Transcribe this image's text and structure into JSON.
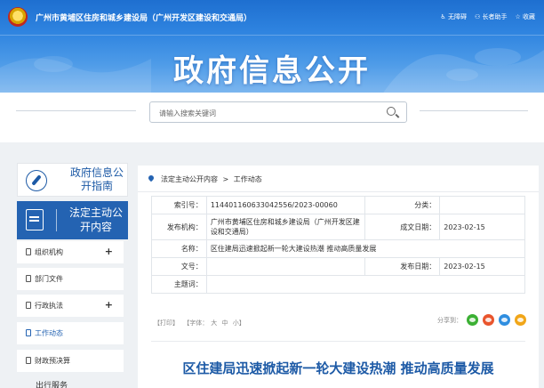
{
  "header": {
    "site_title": "广州市黄埔区住房和城乡建设局（广州开发区建设和交通局）",
    "links": [
      "无障碍",
      "长者助手",
      "收藏"
    ],
    "banner_title": "政府信息公开"
  },
  "search": {
    "placeholder": "请输入搜索关键词"
  },
  "sidebar": {
    "guide_label": "政府信息公开指南",
    "active_label": "法定主动公开内容",
    "items": [
      {
        "label": "组织机构",
        "expandable": true
      },
      {
        "label": "部门文件",
        "expandable": false
      },
      {
        "label": "行政执法",
        "expandable": true
      },
      {
        "label": "工作动态",
        "expandable": false,
        "current": true
      },
      {
        "label": "财政预决算",
        "expandable": false
      }
    ],
    "more_label": "出行服务"
  },
  "breadcrumb": [
    "法定主动公开内容",
    ">",
    "工作动态"
  ],
  "meta": {
    "index_label": "索引号：",
    "index_value": "114401160633042556/2023-00060",
    "category_label": "分类：",
    "category_value": "",
    "org_label": "发布机构：",
    "org_value": "广州市黄埔区住房和城乡建设局（广州开发区建设和交通局）",
    "created_label": "成文日期：",
    "created_value": "2023-02-15",
    "name_label": "名称：",
    "name_value": "区住建局迅速掀起新一轮大建设热潮 推动高质量发展",
    "docno_label": "文号：",
    "docno_value": "",
    "published_label": "发布日期：",
    "published_value": "2023-02-15",
    "subject_label": "主题词：",
    "subject_value": ""
  },
  "tools": {
    "print": "【打印】",
    "font_label": "【字体：",
    "font_large": "大",
    "font_medium": "中",
    "font_small": "小】",
    "share_label": "分享到："
  },
  "share_colors": [
    "#3cb034",
    "#e9552d",
    "#2f8ee0",
    "#f1a619"
  ],
  "article": {
    "title": "区住建局迅速掀起新一轮大建设热潮 推动高质量发展"
  }
}
